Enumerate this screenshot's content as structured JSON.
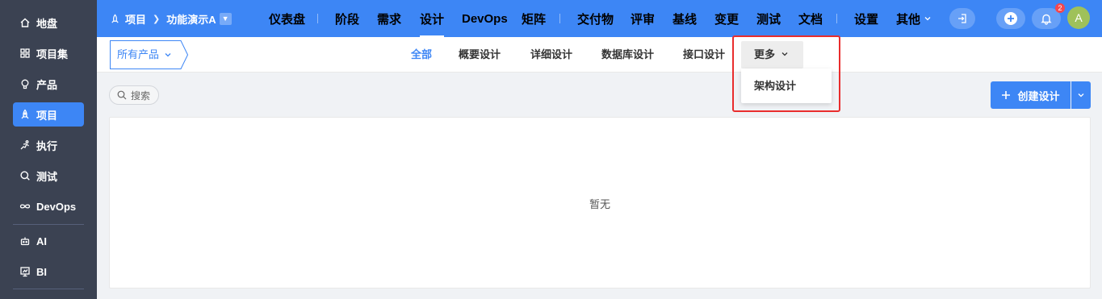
{
  "sidebar": {
    "items": [
      {
        "label": "地盘",
        "icon": "home-icon"
      },
      {
        "label": "项目集",
        "icon": "grid-icon"
      },
      {
        "label": "产品",
        "icon": "bulb-icon"
      },
      {
        "label": "项目",
        "icon": "rocket-icon",
        "active": true
      },
      {
        "label": "执行",
        "icon": "run-icon"
      },
      {
        "label": "测试",
        "icon": "test-icon"
      },
      {
        "label": "DevOps",
        "icon": "infinity-icon"
      },
      {
        "label": "AI",
        "icon": "robot-icon"
      },
      {
        "label": "BI",
        "icon": "chart-icon"
      }
    ]
  },
  "breadcrumb": {
    "root": "项目",
    "current": "功能演示A"
  },
  "topnav": {
    "items": [
      "仪表盘",
      "阶段",
      "需求",
      "设计",
      "DevOps",
      "矩阵",
      "交付物",
      "评审",
      "基线",
      "变更",
      "测试",
      "文档",
      "设置",
      "其他"
    ],
    "active": "设计"
  },
  "notifications": {
    "count": "2"
  },
  "user": {
    "avatar": "A"
  },
  "filter": {
    "product_label": "所有产品"
  },
  "tabs": {
    "items": [
      "全部",
      "概要设计",
      "详细设计",
      "数据库设计",
      "接口设计"
    ],
    "active": "全部",
    "more_label": "更多"
  },
  "more_menu": {
    "items": [
      "架构设计"
    ]
  },
  "search": {
    "label": "搜索"
  },
  "actions": {
    "create_label": "创建设计"
  },
  "content": {
    "empty_text": "暂无"
  },
  "colors": {
    "accent": "#3d86f5",
    "sidebar": "#3b4252",
    "highlight": "#e92d2d"
  }
}
